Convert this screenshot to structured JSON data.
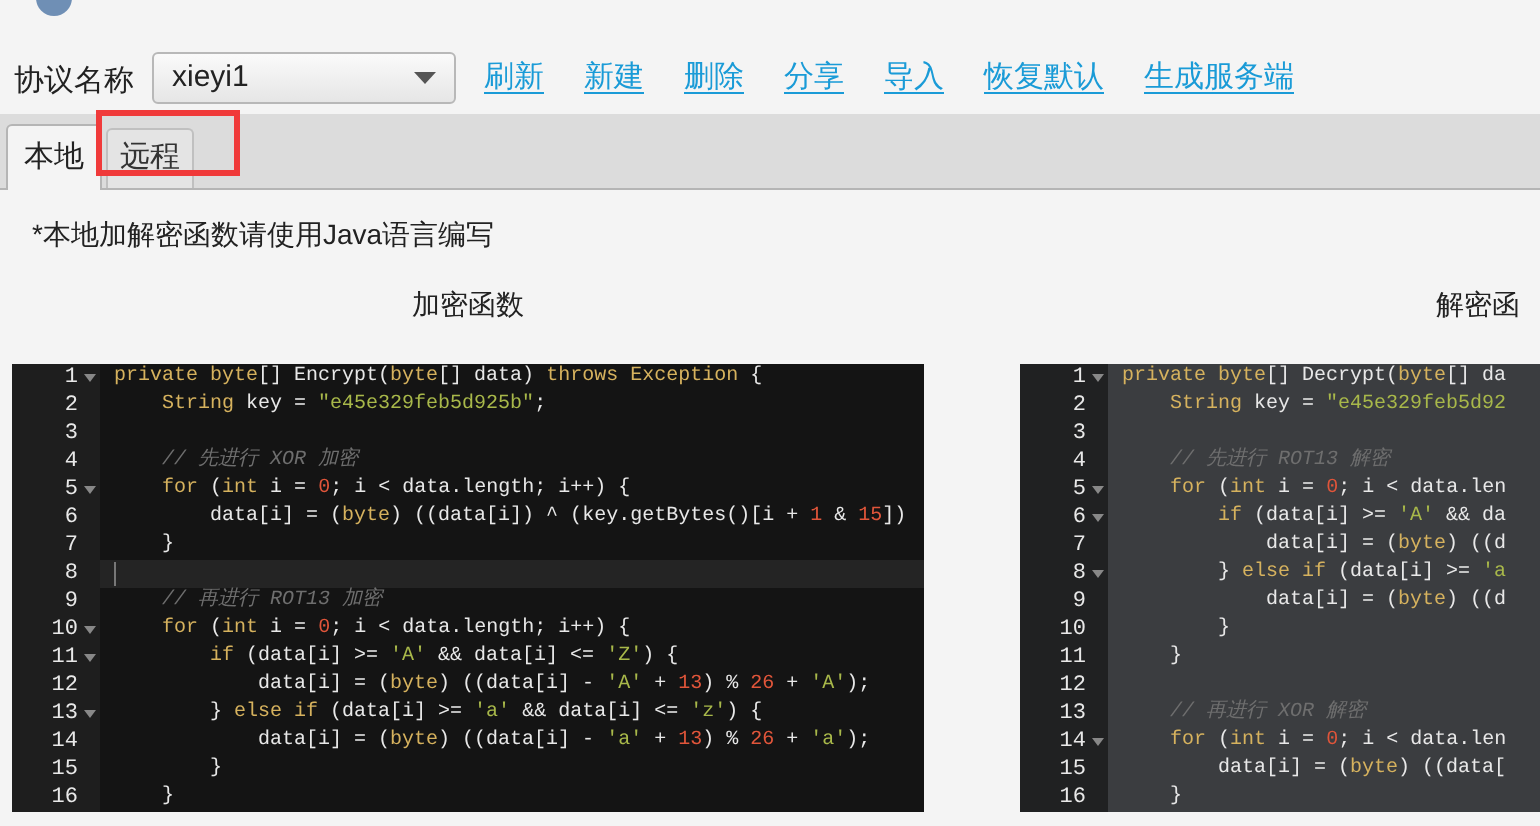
{
  "toolbar": {
    "label": "协议名称",
    "protocol_select": {
      "value": "xieyi1"
    },
    "links": [
      "刷新",
      "新建",
      "删除",
      "分享",
      "导入",
      "恢复默认",
      "生成服务端"
    ]
  },
  "tabs": [
    {
      "label": "本地",
      "selected": true,
      "highlighted": false
    },
    {
      "label": "远程",
      "selected": false,
      "highlighted": true
    }
  ],
  "note": "*本地加解密函数请使用Java语言编写",
  "editors": [
    {
      "heading": "加密函数",
      "focused": true,
      "lines": [
        {
          "n": "1",
          "fold": true,
          "current": false,
          "tokens": [
            {
              "kind": "keyword",
              "text": "private byte"
            },
            {
              "kind": "plain",
              "text": "[] Encrypt("
            },
            {
              "kind": "keyword",
              "text": "byte"
            },
            {
              "kind": "plain",
              "text": "[] data) "
            },
            {
              "kind": "keyword",
              "text": "throws Exception"
            },
            {
              "kind": "plain",
              "text": " {"
            }
          ]
        },
        {
          "n": "2",
          "fold": false,
          "current": false,
          "tokens": [
            {
              "kind": "keyword",
              "text": "    String"
            },
            {
              "kind": "plain",
              "text": " key = "
            },
            {
              "kind": "string",
              "text": "\"e45e329feb5d925b\""
            },
            {
              "kind": "plain",
              "text": ";"
            }
          ]
        },
        {
          "n": "3",
          "fold": false,
          "current": false
        },
        {
          "n": "4",
          "fold": false,
          "current": false,
          "tokens": [
            {
              "kind": "comment",
              "text": "    // 先进行 XOR 加密"
            }
          ]
        },
        {
          "n": "5",
          "fold": true,
          "current": false,
          "tokens": [
            {
              "kind": "keyword",
              "text": "    for"
            },
            {
              "kind": "plain",
              "text": " ("
            },
            {
              "kind": "keyword",
              "text": "int"
            },
            {
              "kind": "plain",
              "text": " i = "
            },
            {
              "kind": "number",
              "text": "0"
            },
            {
              "kind": "plain",
              "text": "; i < data.length; i++) {"
            }
          ]
        },
        {
          "n": "6",
          "fold": false,
          "current": false,
          "tokens": [
            {
              "kind": "plain",
              "text": "        data[i] = ("
            },
            {
              "kind": "keyword",
              "text": "byte"
            },
            {
              "kind": "plain",
              "text": ") ((data[i]) ^ (key.getBytes()[i + "
            },
            {
              "kind": "number",
              "text": "1"
            },
            {
              "kind": "plain",
              "text": " & "
            },
            {
              "kind": "number",
              "text": "15"
            },
            {
              "kind": "plain",
              "text": "])"
            }
          ]
        },
        {
          "n": "7",
          "fold": false,
          "current": false,
          "tokens": [
            {
              "kind": "plain",
              "text": "    }"
            }
          ]
        },
        {
          "n": "8",
          "fold": false,
          "current": true
        },
        {
          "n": "9",
          "fold": false,
          "current": false,
          "tokens": [
            {
              "kind": "comment",
              "text": "    // 再进行 ROT13 加密"
            }
          ]
        },
        {
          "n": "10",
          "fold": true,
          "current": false,
          "tokens": [
            {
              "kind": "keyword",
              "text": "    for"
            },
            {
              "kind": "plain",
              "text": " ("
            },
            {
              "kind": "keyword",
              "text": "int"
            },
            {
              "kind": "plain",
              "text": " i = "
            },
            {
              "kind": "number",
              "text": "0"
            },
            {
              "kind": "plain",
              "text": "; i < data.length; i++) {"
            }
          ]
        },
        {
          "n": "11",
          "fold": true,
          "current": false,
          "tokens": [
            {
              "kind": "keyword",
              "text": "        if"
            },
            {
              "kind": "plain",
              "text": " (data[i] >= "
            },
            {
              "kind": "string",
              "text": "'A'"
            },
            {
              "kind": "plain",
              "text": " && data[i] <= "
            },
            {
              "kind": "string",
              "text": "'Z'"
            },
            {
              "kind": "plain",
              "text": ") {"
            }
          ]
        },
        {
          "n": "12",
          "fold": false,
          "current": false,
          "tokens": [
            {
              "kind": "plain",
              "text": "            data[i] = ("
            },
            {
              "kind": "keyword",
              "text": "byte"
            },
            {
              "kind": "plain",
              "text": ") ((data[i] - "
            },
            {
              "kind": "string",
              "text": "'A'"
            },
            {
              "kind": "plain",
              "text": " + "
            },
            {
              "kind": "number",
              "text": "13"
            },
            {
              "kind": "plain",
              "text": ") % "
            },
            {
              "kind": "number",
              "text": "26"
            },
            {
              "kind": "plain",
              "text": " + "
            },
            {
              "kind": "string",
              "text": "'A'"
            },
            {
              "kind": "plain",
              "text": ");"
            }
          ]
        },
        {
          "n": "13",
          "fold": true,
          "current": false,
          "tokens": [
            {
              "kind": "plain",
              "text": "        } "
            },
            {
              "kind": "keyword",
              "text": "else if"
            },
            {
              "kind": "plain",
              "text": " (data[i] >= "
            },
            {
              "kind": "string",
              "text": "'a'"
            },
            {
              "kind": "plain",
              "text": " && data[i] <= "
            },
            {
              "kind": "string",
              "text": "'z'"
            },
            {
              "kind": "plain",
              "text": ") {"
            }
          ]
        },
        {
          "n": "14",
          "fold": false,
          "current": false,
          "tokens": [
            {
              "kind": "plain",
              "text": "            data[i] = ("
            },
            {
              "kind": "keyword",
              "text": "byte"
            },
            {
              "kind": "plain",
              "text": ") ((data[i] - "
            },
            {
              "kind": "string",
              "text": "'a'"
            },
            {
              "kind": "plain",
              "text": " + "
            },
            {
              "kind": "number",
              "text": "13"
            },
            {
              "kind": "plain",
              "text": ") % "
            },
            {
              "kind": "number",
              "text": "26"
            },
            {
              "kind": "plain",
              "text": " + "
            },
            {
              "kind": "string",
              "text": "'a'"
            },
            {
              "kind": "plain",
              "text": ");"
            }
          ]
        },
        {
          "n": "15",
          "fold": false,
          "current": false,
          "tokens": [
            {
              "kind": "plain",
              "text": "        }"
            }
          ]
        },
        {
          "n": "16",
          "fold": false,
          "current": false,
          "tokens": [
            {
              "kind": "plain",
              "text": "    }"
            }
          ]
        }
      ]
    },
    {
      "heading": "解密函",
      "focused": false,
      "lines": [
        {
          "n": "1",
          "fold": true,
          "current": false,
          "tokens": [
            {
              "kind": "keyword",
              "text": "private byte"
            },
            {
              "kind": "plain",
              "text": "[] Decrypt("
            },
            {
              "kind": "keyword",
              "text": "byte"
            },
            {
              "kind": "plain",
              "text": "[] da"
            }
          ]
        },
        {
          "n": "2",
          "fold": false,
          "current": false,
          "tokens": [
            {
              "kind": "keyword",
              "text": "    String"
            },
            {
              "kind": "plain",
              "text": " key = "
            },
            {
              "kind": "string",
              "text": "\"e45e329feb5d92"
            }
          ]
        },
        {
          "n": "3",
          "fold": false,
          "current": false
        },
        {
          "n": "4",
          "fold": false,
          "current": false,
          "tokens": [
            {
              "kind": "comment",
              "text": "    // 先进行 ROT13 解密"
            }
          ]
        },
        {
          "n": "5",
          "fold": true,
          "current": false,
          "tokens": [
            {
              "kind": "keyword",
              "text": "    for"
            },
            {
              "kind": "plain",
              "text": " ("
            },
            {
              "kind": "keyword",
              "text": "int"
            },
            {
              "kind": "plain",
              "text": " i = "
            },
            {
              "kind": "number",
              "text": "0"
            },
            {
              "kind": "plain",
              "text": "; i < data.len"
            }
          ]
        },
        {
          "n": "6",
          "fold": true,
          "current": false,
          "tokens": [
            {
              "kind": "keyword",
              "text": "        if"
            },
            {
              "kind": "plain",
              "text": " (data[i] >= "
            },
            {
              "kind": "string",
              "text": "'A'"
            },
            {
              "kind": "plain",
              "text": " && da"
            }
          ]
        },
        {
          "n": "7",
          "fold": false,
          "current": false,
          "tokens": [
            {
              "kind": "plain",
              "text": "            data[i] = ("
            },
            {
              "kind": "keyword",
              "text": "byte"
            },
            {
              "kind": "plain",
              "text": ") ((d"
            }
          ]
        },
        {
          "n": "8",
          "fold": true,
          "current": false,
          "tokens": [
            {
              "kind": "plain",
              "text": "        } "
            },
            {
              "kind": "keyword",
              "text": "else if"
            },
            {
              "kind": "plain",
              "text": " (data[i] >= "
            },
            {
              "kind": "string",
              "text": "'a"
            }
          ]
        },
        {
          "n": "9",
          "fold": false,
          "current": false,
          "tokens": [
            {
              "kind": "plain",
              "text": "            data[i] = ("
            },
            {
              "kind": "keyword",
              "text": "byte"
            },
            {
              "kind": "plain",
              "text": ") ((d"
            }
          ]
        },
        {
          "n": "10",
          "fold": false,
          "current": false,
          "tokens": [
            {
              "kind": "plain",
              "text": "        }"
            }
          ]
        },
        {
          "n": "11",
          "fold": false,
          "current": false,
          "tokens": [
            {
              "kind": "plain",
              "text": "    }"
            }
          ]
        },
        {
          "n": "12",
          "fold": false,
          "current": false
        },
        {
          "n": "13",
          "fold": false,
          "current": false,
          "tokens": [
            {
              "kind": "comment",
              "text": "    // 再进行 XOR 解密"
            }
          ]
        },
        {
          "n": "14",
          "fold": true,
          "current": false,
          "tokens": [
            {
              "kind": "keyword",
              "text": "    for"
            },
            {
              "kind": "plain",
              "text": " ("
            },
            {
              "kind": "keyword",
              "text": "int"
            },
            {
              "kind": "plain",
              "text": " i = "
            },
            {
              "kind": "number",
              "text": "0"
            },
            {
              "kind": "plain",
              "text": "; i < data.len"
            }
          ]
        },
        {
          "n": "15",
          "fold": false,
          "current": false,
          "tokens": [
            {
              "kind": "plain",
              "text": "        data[i] = ("
            },
            {
              "kind": "keyword",
              "text": "byte"
            },
            {
              "kind": "plain",
              "text": ") ((data["
            }
          ]
        },
        {
          "n": "16",
          "fold": false,
          "current": false,
          "tokens": [
            {
              "kind": "plain",
              "text": "    }"
            }
          ]
        }
      ]
    }
  ]
}
